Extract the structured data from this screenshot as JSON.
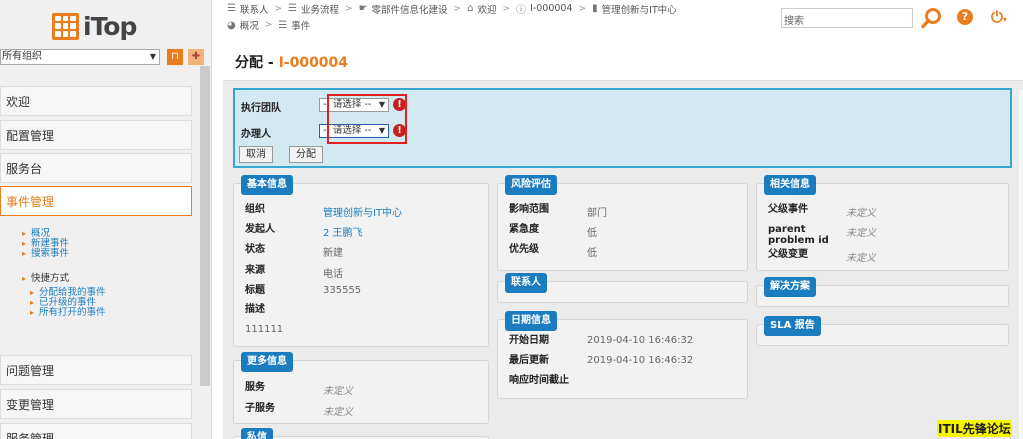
{
  "logo": {
    "text": "iTop"
  },
  "sidebar": {
    "org_select": "所有组织",
    "menus": {
      "welcome": "欢迎",
      "config": "配置管理",
      "service_desk": "服务台",
      "incident": "事件管理",
      "problem": "问题管理",
      "change": "变更管理",
      "service_mgmt": "服务管理"
    },
    "incident_items": [
      "概况",
      "新建事件",
      "搜索事件"
    ],
    "shortcuts_label": "快捷方式",
    "shortcut_items": [
      "分配给我的事件",
      "已升级的事件",
      "所有打开的事件"
    ]
  },
  "breadcrumbs": {
    "row1": [
      "联系人",
      "业务流程",
      "零部件信息化建设",
      "欢迎",
      "I-000004",
      "管理创新与IT中心"
    ],
    "row2": [
      "概况",
      "事件"
    ]
  },
  "search": {
    "placeholder": "搜索"
  },
  "page": {
    "title_prefix": "分配 - ",
    "ref": "I-000004"
  },
  "form": {
    "team_label": "执行团队",
    "agent_label": "办理人",
    "select_placeholder": "-- 请选择 --",
    "cancel": "取消",
    "assign": "分配"
  },
  "basic": {
    "legend": "基本信息",
    "org_k": "组织",
    "org_v": "管理创新与IT中心",
    "caller_k": "发起人",
    "caller_v": "2 王鹏飞",
    "status_k": "状态",
    "status_v": "新建",
    "origin_k": "来源",
    "origin_v": "电话",
    "title_k": "标题",
    "title_v": "335555",
    "desc_k": "描述",
    "desc_v": "111111"
  },
  "more": {
    "legend": "更多信息",
    "service_k": "服务",
    "service_v": "未定义",
    "subservice_k": "子服务",
    "subservice_v": "未定义"
  },
  "private": {
    "legend": "私信"
  },
  "risk": {
    "legend": "风险评估",
    "impact_k": "影响范围",
    "impact_v": "部门",
    "urgency_k": "紧急度",
    "urgency_v": "低",
    "priority_k": "优先级",
    "priority_v": "低"
  },
  "contacts": {
    "legend": "联系人"
  },
  "dates": {
    "legend": "日期信息",
    "start_k": "开始日期",
    "start_v": "2019-04-10 16:46:32",
    "update_k": "最后更新",
    "update_v": "2019-04-10 16:46:32",
    "tto_k": "响应时间截止"
  },
  "related": {
    "legend": "相关信息",
    "parent_incident_k": "父级事件",
    "parent_incident_v": "未定义",
    "parent_problem_k": "parent problem id",
    "parent_problem_v": "未定义",
    "parent_change_k": "父级变更",
    "parent_change_v": "未定义"
  },
  "resolution": {
    "legend": "解决方案"
  },
  "sla": {
    "legend": "SLA 报告"
  },
  "watermark": "ITIL先锋论坛",
  "colors": {
    "accent": "#ea7d1e",
    "link": "#1c7cc0",
    "form_bg": "#d2e9f1",
    "error": "#c81e1e"
  }
}
